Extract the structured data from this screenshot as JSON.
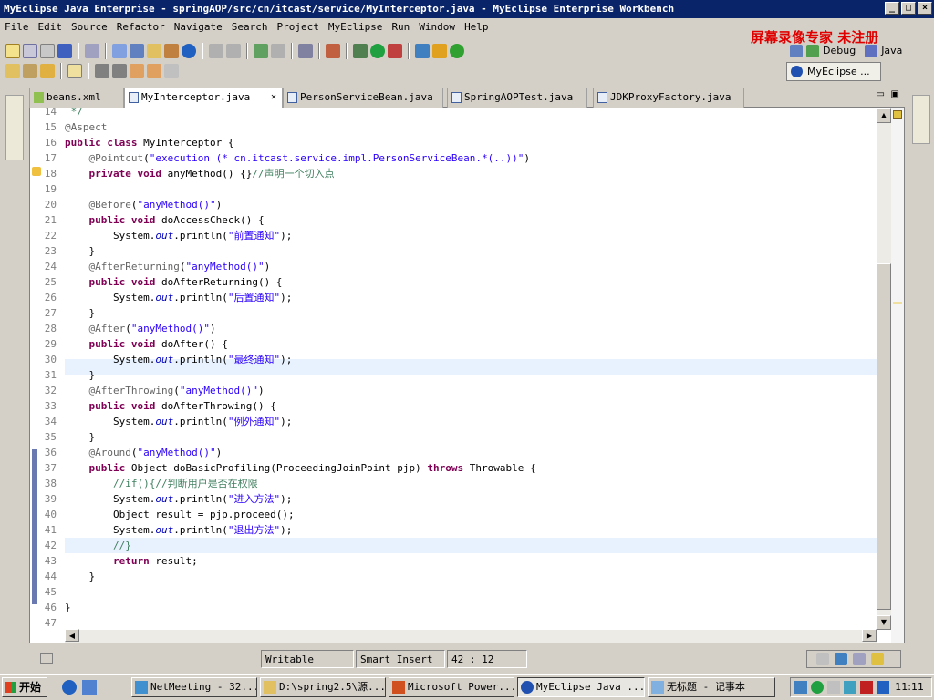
{
  "window": {
    "title": "MyEclipse Java Enterprise - springAOP/src/cn/itcast/service/MyInterceptor.java - MyEclipse Enterprise Workbench"
  },
  "menu": [
    "File",
    "Edit",
    "Source",
    "Refactor",
    "Navigate",
    "Search",
    "Project",
    "MyEclipse",
    "Run",
    "Window",
    "Help"
  ],
  "watermark": "屏幕录像专家 未注册",
  "perspectives": {
    "debug": "Debug",
    "java": "Java",
    "myeclipse": "MyEclipse ..."
  },
  "tabs": [
    {
      "label": "beans.xml",
      "active": false
    },
    {
      "label": "MyInterceptor.java",
      "active": true
    },
    {
      "label": "PersonServiceBean.java",
      "active": false
    },
    {
      "label": "SpringAOPTest.java",
      "active": false
    },
    {
      "label": "JDKProxyFactory.java",
      "active": false
    }
  ],
  "editor": {
    "line_numbers": [
      "14",
      "15",
      "16",
      "17",
      "18",
      "19",
      "20",
      "21",
      "22",
      "23",
      "24",
      "25",
      "26",
      "27",
      "28",
      "29",
      "30",
      "31",
      "32",
      "33",
      "34",
      "35",
      "36",
      "37",
      "38",
      "39",
      "40",
      "41",
      "42",
      "43",
      "44",
      "45",
      "46",
      "47"
    ],
    "current_line": "30"
  },
  "status": {
    "writable": "Writable",
    "insert_mode": "Smart Insert",
    "position": "42 : 12"
  },
  "taskbar": {
    "start": "开始",
    "tasks": [
      "NetMeeting - 32...",
      "D:\\spring2.5\\源...",
      "Microsoft Power...",
      "MyEclipse Java ...",
      "无标题 - 记事本"
    ],
    "clock": "11:11"
  },
  "colors": {
    "keyword": "#7f0055",
    "string": "#2a00ff",
    "annotation": "#646464",
    "field": "#0000c0",
    "title_bar": "#0a246a"
  }
}
